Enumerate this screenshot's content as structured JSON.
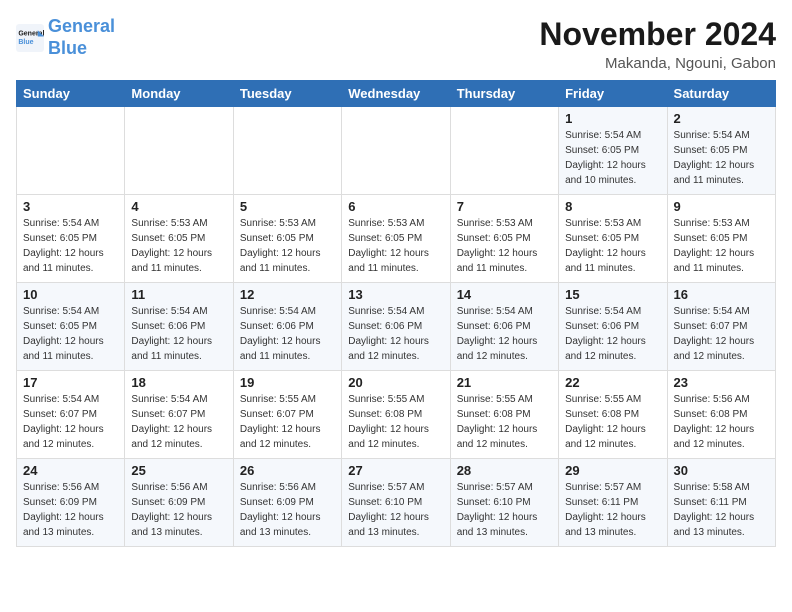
{
  "logo": {
    "line1": "General",
    "line2": "Blue"
  },
  "title": "November 2024",
  "location": "Makanda, Ngouni, Gabon",
  "weekdays": [
    "Sunday",
    "Monday",
    "Tuesday",
    "Wednesday",
    "Thursday",
    "Friday",
    "Saturday"
  ],
  "weeks": [
    [
      {
        "day": "",
        "info": ""
      },
      {
        "day": "",
        "info": ""
      },
      {
        "day": "",
        "info": ""
      },
      {
        "day": "",
        "info": ""
      },
      {
        "day": "",
        "info": ""
      },
      {
        "day": "1",
        "info": "Sunrise: 5:54 AM\nSunset: 6:05 PM\nDaylight: 12 hours\nand 10 minutes."
      },
      {
        "day": "2",
        "info": "Sunrise: 5:54 AM\nSunset: 6:05 PM\nDaylight: 12 hours\nand 11 minutes."
      }
    ],
    [
      {
        "day": "3",
        "info": "Sunrise: 5:54 AM\nSunset: 6:05 PM\nDaylight: 12 hours\nand 11 minutes."
      },
      {
        "day": "4",
        "info": "Sunrise: 5:53 AM\nSunset: 6:05 PM\nDaylight: 12 hours\nand 11 minutes."
      },
      {
        "day": "5",
        "info": "Sunrise: 5:53 AM\nSunset: 6:05 PM\nDaylight: 12 hours\nand 11 minutes."
      },
      {
        "day": "6",
        "info": "Sunrise: 5:53 AM\nSunset: 6:05 PM\nDaylight: 12 hours\nand 11 minutes."
      },
      {
        "day": "7",
        "info": "Sunrise: 5:53 AM\nSunset: 6:05 PM\nDaylight: 12 hours\nand 11 minutes."
      },
      {
        "day": "8",
        "info": "Sunrise: 5:53 AM\nSunset: 6:05 PM\nDaylight: 12 hours\nand 11 minutes."
      },
      {
        "day": "9",
        "info": "Sunrise: 5:53 AM\nSunset: 6:05 PM\nDaylight: 12 hours\nand 11 minutes."
      }
    ],
    [
      {
        "day": "10",
        "info": "Sunrise: 5:54 AM\nSunset: 6:05 PM\nDaylight: 12 hours\nand 11 minutes."
      },
      {
        "day": "11",
        "info": "Sunrise: 5:54 AM\nSunset: 6:06 PM\nDaylight: 12 hours\nand 11 minutes."
      },
      {
        "day": "12",
        "info": "Sunrise: 5:54 AM\nSunset: 6:06 PM\nDaylight: 12 hours\nand 11 minutes."
      },
      {
        "day": "13",
        "info": "Sunrise: 5:54 AM\nSunset: 6:06 PM\nDaylight: 12 hours\nand 12 minutes."
      },
      {
        "day": "14",
        "info": "Sunrise: 5:54 AM\nSunset: 6:06 PM\nDaylight: 12 hours\nand 12 minutes."
      },
      {
        "day": "15",
        "info": "Sunrise: 5:54 AM\nSunset: 6:06 PM\nDaylight: 12 hours\nand 12 minutes."
      },
      {
        "day": "16",
        "info": "Sunrise: 5:54 AM\nSunset: 6:07 PM\nDaylight: 12 hours\nand 12 minutes."
      }
    ],
    [
      {
        "day": "17",
        "info": "Sunrise: 5:54 AM\nSunset: 6:07 PM\nDaylight: 12 hours\nand 12 minutes."
      },
      {
        "day": "18",
        "info": "Sunrise: 5:54 AM\nSunset: 6:07 PM\nDaylight: 12 hours\nand 12 minutes."
      },
      {
        "day": "19",
        "info": "Sunrise: 5:55 AM\nSunset: 6:07 PM\nDaylight: 12 hours\nand 12 minutes."
      },
      {
        "day": "20",
        "info": "Sunrise: 5:55 AM\nSunset: 6:08 PM\nDaylight: 12 hours\nand 12 minutes."
      },
      {
        "day": "21",
        "info": "Sunrise: 5:55 AM\nSunset: 6:08 PM\nDaylight: 12 hours\nand 12 minutes."
      },
      {
        "day": "22",
        "info": "Sunrise: 5:55 AM\nSunset: 6:08 PM\nDaylight: 12 hours\nand 12 minutes."
      },
      {
        "day": "23",
        "info": "Sunrise: 5:56 AM\nSunset: 6:08 PM\nDaylight: 12 hours\nand 12 minutes."
      }
    ],
    [
      {
        "day": "24",
        "info": "Sunrise: 5:56 AM\nSunset: 6:09 PM\nDaylight: 12 hours\nand 13 minutes."
      },
      {
        "day": "25",
        "info": "Sunrise: 5:56 AM\nSunset: 6:09 PM\nDaylight: 12 hours\nand 13 minutes."
      },
      {
        "day": "26",
        "info": "Sunrise: 5:56 AM\nSunset: 6:09 PM\nDaylight: 12 hours\nand 13 minutes."
      },
      {
        "day": "27",
        "info": "Sunrise: 5:57 AM\nSunset: 6:10 PM\nDaylight: 12 hours\nand 13 minutes."
      },
      {
        "day": "28",
        "info": "Sunrise: 5:57 AM\nSunset: 6:10 PM\nDaylight: 12 hours\nand 13 minutes."
      },
      {
        "day": "29",
        "info": "Sunrise: 5:57 AM\nSunset: 6:11 PM\nDaylight: 12 hours\nand 13 minutes."
      },
      {
        "day": "30",
        "info": "Sunrise: 5:58 AM\nSunset: 6:11 PM\nDaylight: 12 hours\nand 13 minutes."
      }
    ]
  ]
}
